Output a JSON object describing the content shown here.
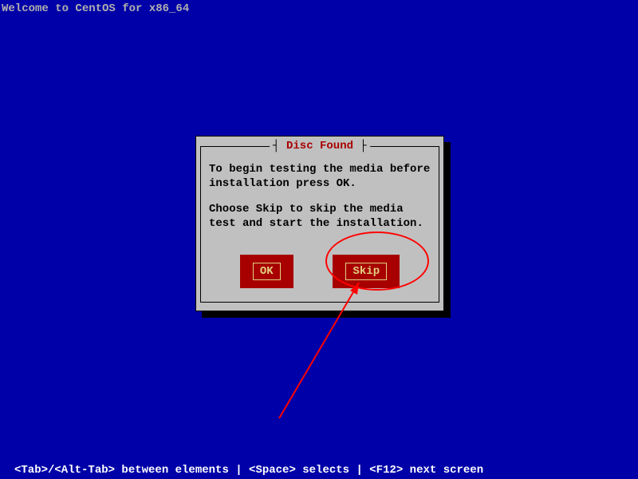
{
  "header": {
    "title": "Welcome to CentOS for x86_64"
  },
  "dialog": {
    "title_left_bracket": "┤ ",
    "title": "Disc Found",
    "title_right_bracket": " ├",
    "para1": "To begin testing the media before installation press OK.",
    "para2": "Choose Skip to skip the media test and start the installation.",
    "buttons": {
      "ok_label": "OK",
      "skip_label": "Skip"
    }
  },
  "footer": {
    "text": "<Tab>/<Alt-Tab> between elements  | <Space> selects | <F12> next screen"
  }
}
